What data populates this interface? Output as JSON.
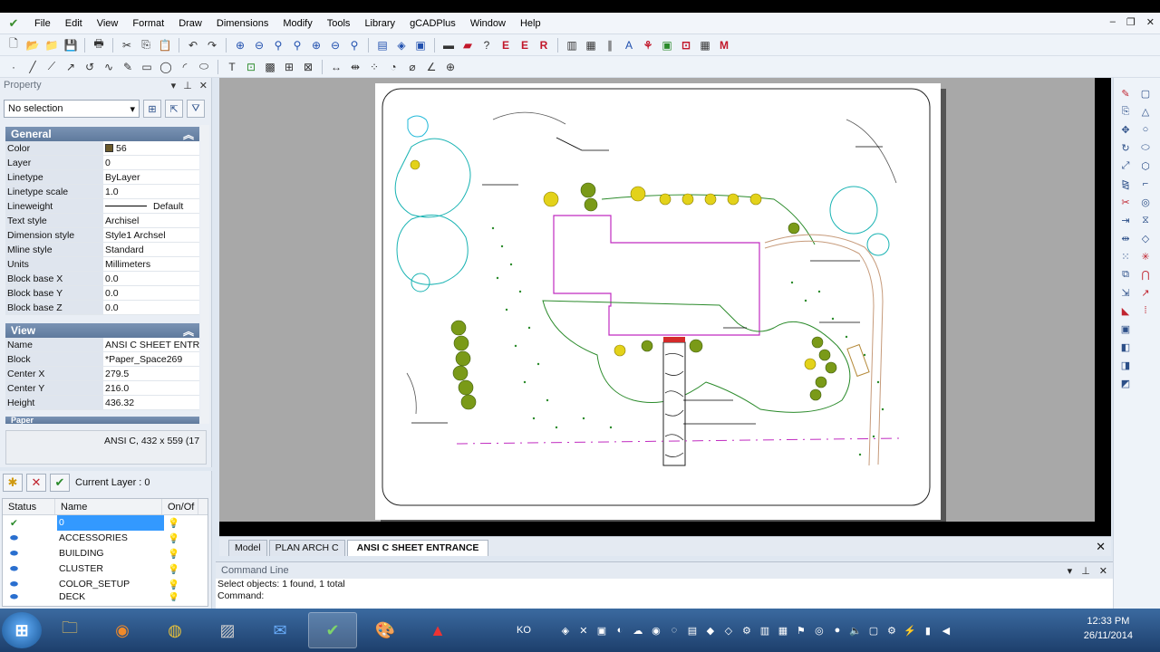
{
  "menu": {
    "items": [
      "File",
      "Edit",
      "View",
      "Format",
      "Draw",
      "Dimensions",
      "Modify",
      "Tools",
      "Library",
      "gCADPlus",
      "Window",
      "Help"
    ]
  },
  "property": {
    "title": "Property",
    "selection": "No selection",
    "general_header": "General",
    "general": [
      {
        "k": "Color",
        "v": "56"
      },
      {
        "k": "Layer",
        "v": "0"
      },
      {
        "k": "Linetype",
        "v": "ByLayer"
      },
      {
        "k": "Linetype scale",
        "v": "1.0"
      },
      {
        "k": "Lineweight",
        "v": "Default"
      },
      {
        "k": "Text style",
        "v": "Archisel"
      },
      {
        "k": "Dimension style",
        "v": "Style1 Archsel"
      },
      {
        "k": "Mline style",
        "v": "Standard"
      },
      {
        "k": "Units",
        "v": "Millimeters"
      },
      {
        "k": "Block base X",
        "v": "0.0"
      },
      {
        "k": "Block base Y",
        "v": "0.0"
      },
      {
        "k": "Block base Z",
        "v": "0.0"
      }
    ],
    "view_header": "View",
    "view": [
      {
        "k": "Name",
        "v": "ANSI C SHEET ENTRA"
      },
      {
        "k": "Block",
        "v": "*Paper_Space269"
      },
      {
        "k": "Center X",
        "v": "279.5"
      },
      {
        "k": "Center Y",
        "v": "216.0"
      },
      {
        "k": "Height",
        "v": "436.32"
      }
    ],
    "paper_header": "Paper",
    "description": "ANSI C,  432 x 559 (17"
  },
  "layers": {
    "current": "Current Layer : 0",
    "col_status": "Status",
    "col_name": "Name",
    "col_onoff": "On/Of",
    "rows": [
      "0",
      "ACCESSORIES",
      "BUILDING",
      "CLUSTER",
      "COLOR_SETUP",
      "DECK"
    ]
  },
  "tabs": [
    "Model",
    "PLAN ARCH C",
    "ANSI C SHEET ENTRANCE"
  ],
  "command": {
    "title": "Command Line",
    "line1": "Select objects: 1 found,  1 total",
    "line2": "Command:"
  },
  "taskbar": {
    "lang": "KO",
    "time": "12:33 PM",
    "date": "26/11/2014"
  },
  "colors": {
    "accent": "#3399ff",
    "section_header": "#6e87aa",
    "plan_green": "#2a8a2a",
    "plan_cyan": "#19b3b3",
    "plan_magenta": "#c02bc0"
  }
}
